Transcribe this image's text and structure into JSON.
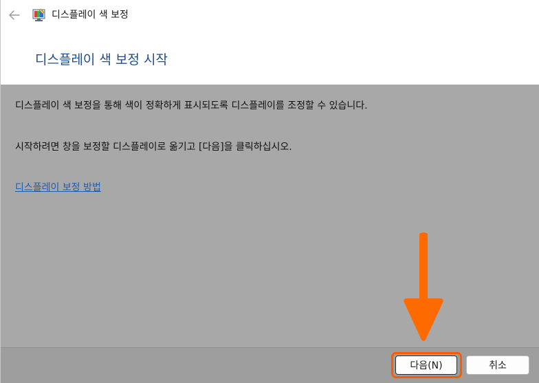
{
  "window": {
    "title": "디스플레이 색 보정",
    "back_icon": "back-arrow-icon",
    "app_icon": "display-color-calibration-icon"
  },
  "header": {
    "heading": "디스플레이 색 보정 시작"
  },
  "content": {
    "paragraph1": "디스플레이 색 보정을 통해 색이 정확하게 표시되도록 디스플레이를 조정할 수 있습니다.",
    "paragraph2": "시작하려면 창을 보정할 디스플레이로 옮기고 [다음]을 클릭하십시오.",
    "help_link": "디스플레이 보정 방법"
  },
  "footer": {
    "next_label": "다음(N)",
    "cancel_label": "취소"
  },
  "annotation": {
    "arrow_color": "#ff6a00",
    "highlight_color": "#ff5a00"
  }
}
